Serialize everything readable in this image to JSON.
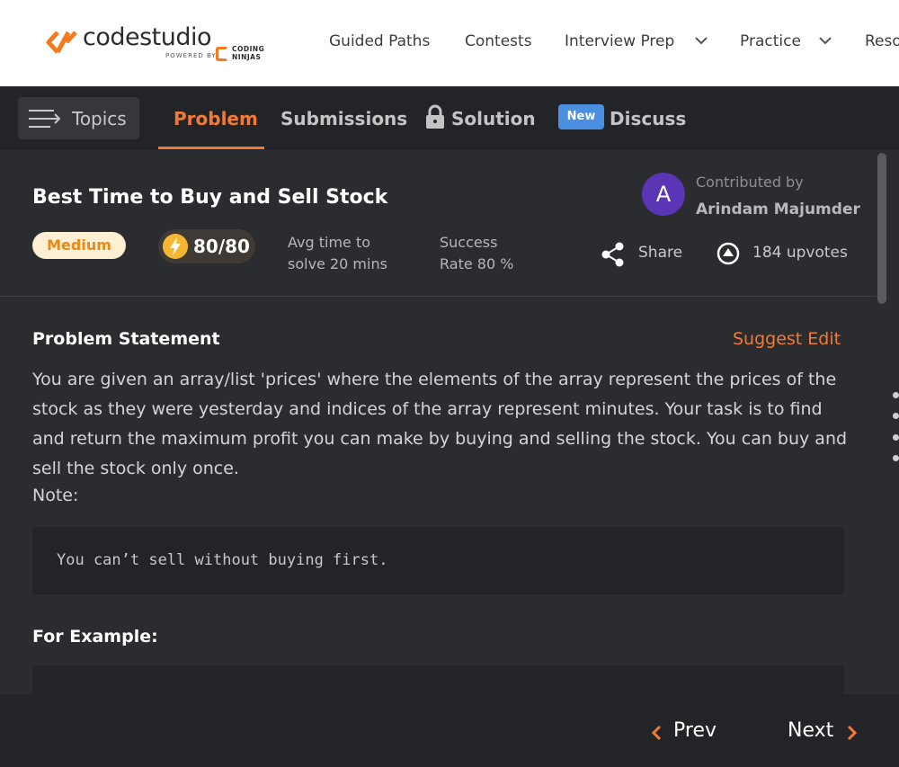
{
  "brand": {
    "name": "codestudio",
    "powered_by": "POWERED BY",
    "partner_line1": "CODING",
    "partner_line2": "NINJAS",
    "accent": "#f47a34"
  },
  "nav": {
    "items": [
      {
        "label": "Guided Paths"
      },
      {
        "label": "Contests"
      },
      {
        "label": "Interview Prep",
        "has_dropdown": true
      },
      {
        "label": "Practice",
        "has_dropdown": true
      },
      {
        "label": "Reso"
      }
    ]
  },
  "tabs": {
    "topics": "Topics",
    "items": [
      {
        "label": "Problem",
        "active": true
      },
      {
        "label": "Submissions"
      },
      {
        "label": "Solution",
        "icon": "lock-icon"
      },
      {
        "label": "Discuss",
        "badge": "New"
      }
    ]
  },
  "problem": {
    "title": "Best Time to Buy and Sell Stock",
    "difficulty": "Medium",
    "points": "80/80",
    "avg_time_line1": "Avg time to",
    "avg_time_line2": "solve 20 mins",
    "success_line1": "Success",
    "success_line2": "Rate 80 %",
    "contributor_label": "Contributed by",
    "contributor_name": "Arindam Majumder",
    "contributor_initial": "A",
    "share_label": "Share",
    "upvotes_label": "184 upvotes"
  },
  "statement": {
    "heading": "Problem Statement",
    "suggest_edit": "Suggest Edit",
    "text": "You are given an array/list 'prices' where the elements of the array represent the prices of the stock as they were yesterday and indices of the array represent minutes. Your task is to find and return the maximum profit you can make by buying and selling the stock. You can buy and sell the stock only once.",
    "note_label": "Note:",
    "note_code": "You can’t sell without buying first.",
    "example_heading": "For Example:"
  },
  "footer": {
    "prev": "Prev",
    "next": "Next"
  }
}
